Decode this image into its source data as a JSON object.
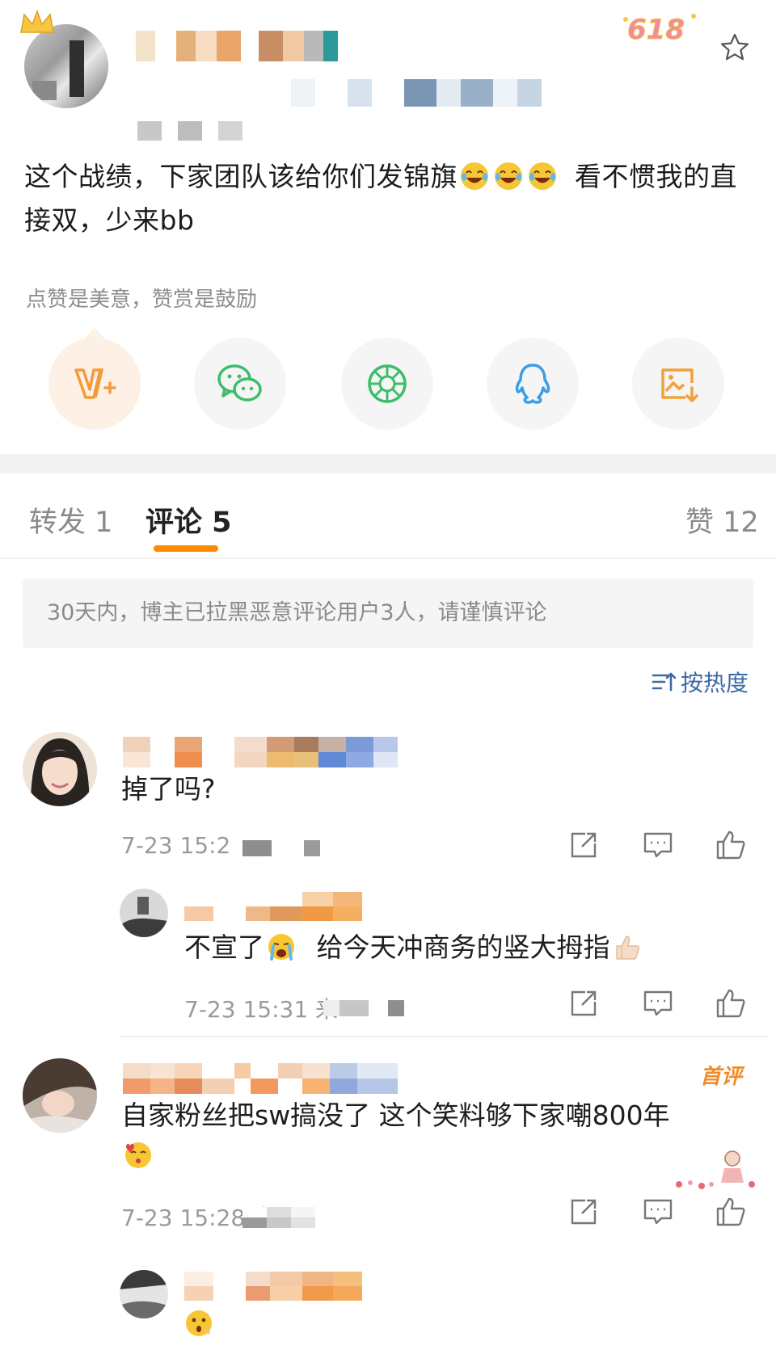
{
  "post": {
    "text_part1": "这个战绩，下家团队该给你们发锦旗",
    "text_part2": "看不惯我的直接双，少来bb",
    "badge": "618",
    "reward_hint": "点赞是美意，赞赏是鼓励"
  },
  "tabs": [
    {
      "label": "转发 1"
    },
    {
      "label": "评论 5"
    },
    {
      "label": "赞 12"
    }
  ],
  "notice": "30天内，博主已拉黑恶意评论用户3人，请谨慎评论",
  "sort_label": "按热度",
  "comments": [
    {
      "text": "掉了吗?",
      "time": "7-23 15:2"
    },
    {
      "text": "不宣了",
      "text_after": "给今天冲商务的竖大拇指",
      "time": "7-23 15:31 来"
    },
    {
      "badge": "首评",
      "text": "自家粉丝把sw搞没了 这个笑料够下家嘲800年",
      "time": "7-23 15:28 来"
    },
    {
      "text": ""
    }
  ],
  "colors": {
    "accent": "#ff8a00",
    "link": "#3c6aa6",
    "muted": "#8a8a8a"
  }
}
